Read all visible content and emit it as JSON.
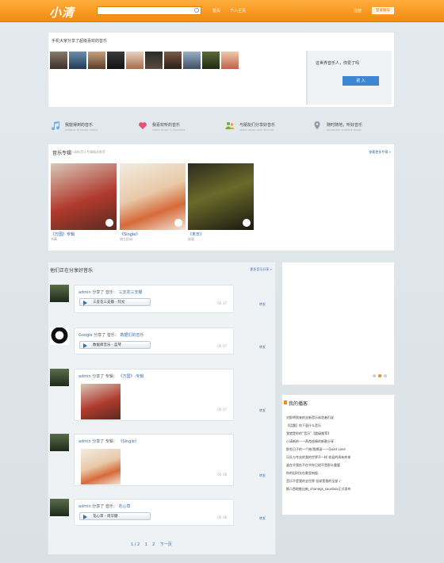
{
  "header": {
    "logo": "小清",
    "search_placeholder": "",
    "nav": [
      "首页",
      "个人主页"
    ],
    "register": "注册",
    "login": "登录账号"
  },
  "hero": {
    "title": "手机大家分享了超级喜欢的音乐",
    "panel_text": "这世界音乐人，你爱了吗",
    "enter": "进 入"
  },
  "features": [
    {
      "title": "我能得到的音乐",
      "sub": "millions of music tracks",
      "icon": "music-note-icon"
    },
    {
      "title": "我喜欢听的音乐",
      "sub": "share music & favorites",
      "icon": "heart-icon"
    },
    {
      "title": "与朋友们分享好音乐",
      "sub": "share music with friends",
      "icon": "people-icon"
    },
    {
      "title": "随时随地，听好音乐",
      "sub": "anywhere anytime music",
      "icon": "location-pin-icon"
    }
  ],
  "albums": {
    "title": "音乐专辑",
    "subtitle": "小清新音乐专辑精选推荐",
    "more": "查看更多专辑 »",
    "items": [
      {
        "name": "《万国》专辑",
        "tag": "节奏"
      },
      {
        "name": "《Single》",
        "tag": "独立民谣"
      },
      {
        "name": "《末日》",
        "tag": "摇滚"
      }
    ]
  },
  "feed": {
    "title": "他们正在分享好音乐",
    "more": "更多音乐分享 »",
    "entries": [
      {
        "user": "admin",
        "verb": "分享了",
        "type": "音乐：",
        "target": "三支花三支瓣",
        "track": "三支花三支瓣 - 阿文",
        "time": "05-17",
        "repost": "转发"
      },
      {
        "user": "Google",
        "verb": "分享了",
        "type": "音乐：",
        "target": "数据们的音乐",
        "track": "数据库音乐 - 蓝琴",
        "time": "05-17",
        "repost": "转发"
      },
      {
        "user": "admin",
        "verb": "分享了",
        "type": "专辑：",
        "target": "《万国》-专辑",
        "time": "05-17",
        "repost": "转发"
      },
      {
        "user": "admin",
        "verb": "分享了",
        "type": "专辑：",
        "target": "《Single》",
        "time": "05-16",
        "repost": "转发"
      },
      {
        "user": "admin",
        "verb": "分享了",
        "type": "音乐：",
        "target": "花心草",
        "track": "花心草 - 周华健",
        "time": "05-16",
        "repost": "转发"
      }
    ],
    "pager": [
      "1 / 2",
      "1",
      "2",
      "下一页"
    ]
  },
  "board": {
    "title": "我的播客",
    "items": [
      "对即将到来的全新音乐体验者们说",
      "【话题】你下面什么音乐",
      "我就是你的“音乐”【超级推荐】",
      "小清新的——两首很棒的新歌分享",
      "那些日子的一个她/我想说——Quiet Love",
      "乐队与专业的我的世界不一样 欢迎的再有你来",
      "谁在乎我在不在乎你已经不是那么重要",
      "你的旧时光在歌里响起...",
      "音乐不是我的全世界 但却是我的全部 ♪",
      "换二首地推出新_chanegs_sounbox正式发布"
    ]
  },
  "colors": {
    "header": "#f39317",
    "link": "#3a6ea5",
    "button": "#3e86d1"
  }
}
